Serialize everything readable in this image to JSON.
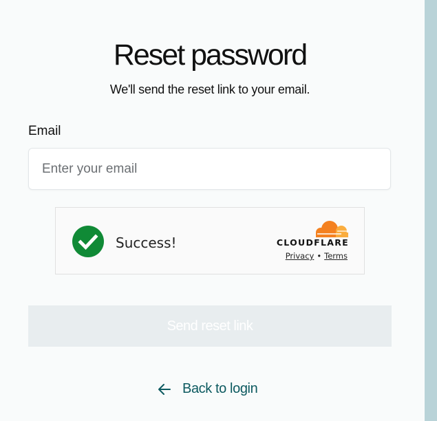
{
  "header": {
    "title": "Reset password",
    "subtitle": "We'll send the reset link to your email."
  },
  "form": {
    "email_label": "Email",
    "email_placeholder": "Enter your email",
    "email_value": ""
  },
  "captcha": {
    "status_text": "Success!",
    "status_icon": "check-circle-icon",
    "brand": "CLOUDFLARE",
    "privacy_label": "Privacy",
    "separator": "•",
    "terms_label": "Terms",
    "success_color": "#108a36",
    "brand_orange": "#f48120"
  },
  "actions": {
    "send_label": "Send reset link",
    "back_label": "Back to login",
    "back_icon": "arrow-left-icon"
  },
  "colors": {
    "link": "#0d5a60",
    "button_disabled_bg": "#e8edef"
  }
}
